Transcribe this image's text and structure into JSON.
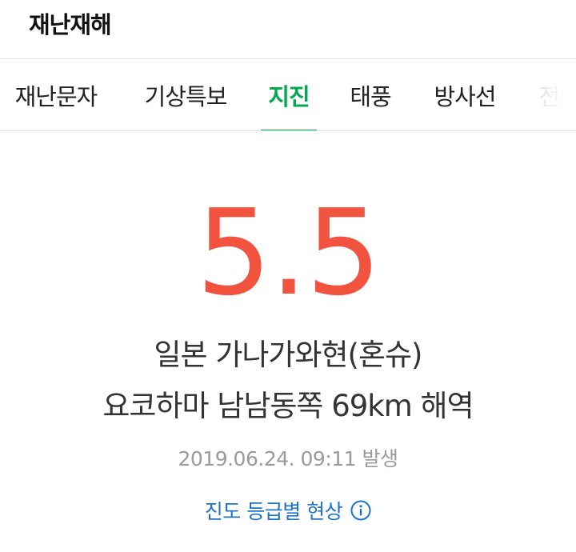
{
  "header": {
    "title": "재난재해"
  },
  "tabs": [
    {
      "label": "재난문자",
      "active": false
    },
    {
      "label": "기상특보",
      "active": false
    },
    {
      "label": "지진",
      "active": true
    },
    {
      "label": "태풍",
      "active": false
    },
    {
      "label": "방사선",
      "active": false
    },
    {
      "label": "전력",
      "active": false
    }
  ],
  "earthquake": {
    "magnitude": "5.5",
    "location_line1": "일본 가나가와현(혼슈)",
    "location_line2": "요코하마 남남동쪽 69km 해역",
    "timestamp": "2019.06.24. 09:11 발생",
    "intensity_link": "진도 등급별 현상"
  },
  "colors": {
    "accent": "#03a94d",
    "magnitude": "#f2533f",
    "link": "#1e74c8"
  },
  "icons": {
    "intensity_link": "info-icon"
  }
}
